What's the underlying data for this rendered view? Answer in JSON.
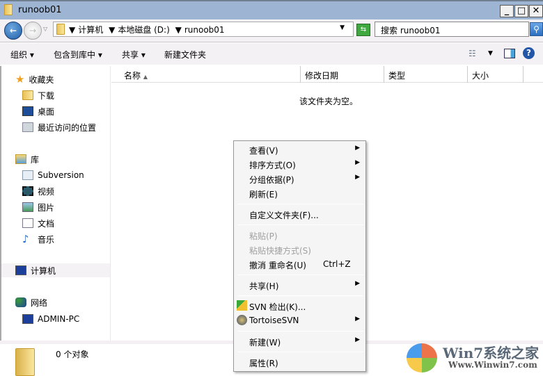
{
  "window": {
    "title": "runoob01"
  },
  "address": {
    "crumbs": [
      "计算机",
      "本地磁盘 (D:)",
      "runoob01"
    ],
    "search_placeholder": "搜索 runoob01"
  },
  "toolbar": {
    "organize": "组织",
    "include_library": "包含到库中",
    "share": "共享",
    "new_folder": "新建文件夹"
  },
  "columns": [
    "名称",
    "修改日期",
    "类型",
    "大小"
  ],
  "sidebar": {
    "favorites": {
      "label": "收藏夹",
      "items": [
        "下载",
        "桌面",
        "最近访问的位置"
      ]
    },
    "libraries": {
      "label": "库",
      "items": [
        "Subversion",
        "视频",
        "图片",
        "文档",
        "音乐"
      ]
    },
    "computer": "计算机",
    "network": {
      "label": "网络",
      "items": [
        "ADMIN-PC"
      ]
    }
  },
  "main": {
    "empty_text": "该文件夹为空。"
  },
  "status": {
    "count": "0 个对象"
  },
  "context_menu": {
    "view": "查看(V)",
    "sort": "排序方式(O)",
    "group": "分组依据(P)",
    "refresh": "刷新(E)",
    "customize": "自定义文件夹(F)...",
    "paste": "粘贴(P)",
    "paste_shortcut": "粘贴快捷方式(S)",
    "undo": "撤消 重命名(U)",
    "undo_shortcut": "Ctrl+Z",
    "share": "共享(H)",
    "svn_checkout": "SVN 检出(K)...",
    "tortoise": "TortoiseSVN",
    "new": "新建(W)",
    "properties": "属性(R)"
  },
  "watermark": {
    "brand": "Win7系统之家",
    "url": "Www.Winwin7.com"
  }
}
